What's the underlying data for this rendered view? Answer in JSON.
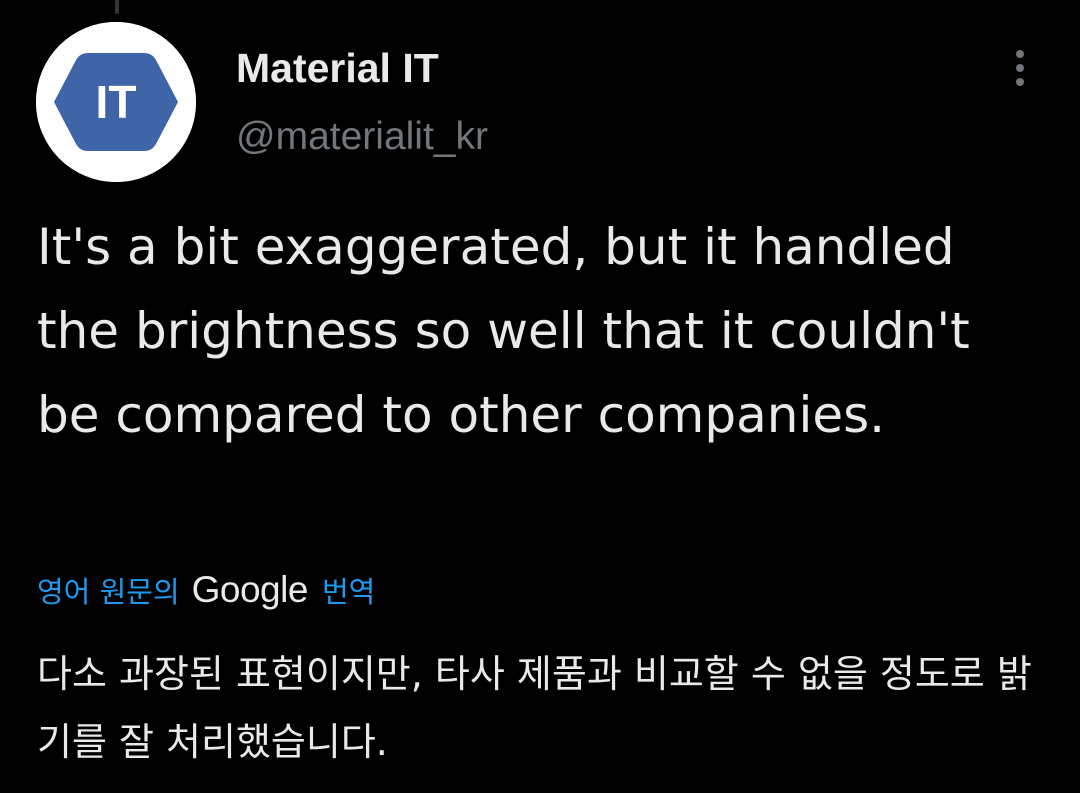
{
  "tweet": {
    "avatar": {
      "initials": "IT",
      "bg_color": "#ffffff",
      "shape_color": "#3f64a8"
    },
    "author_name": "Material IT",
    "handle": "@materialit_kr",
    "more_icon": "more-vertical-icon",
    "text": "It's a bit exaggerated, but it handled the brightness so well that it couldn't be compared to other companies.",
    "translation": {
      "label_prefix": "영어 원문의",
      "provider": "Google",
      "label_suffix": "번역",
      "text": "다소 과장된 표현이지만, 타사 제품과 비교할 수 없을 정도로 밝기를 잘 처리했습니다."
    }
  },
  "colors": {
    "background": "#000000",
    "primary_text": "#e7e9ea",
    "secondary_text": "#71767b",
    "link": "#1d9bf0"
  }
}
